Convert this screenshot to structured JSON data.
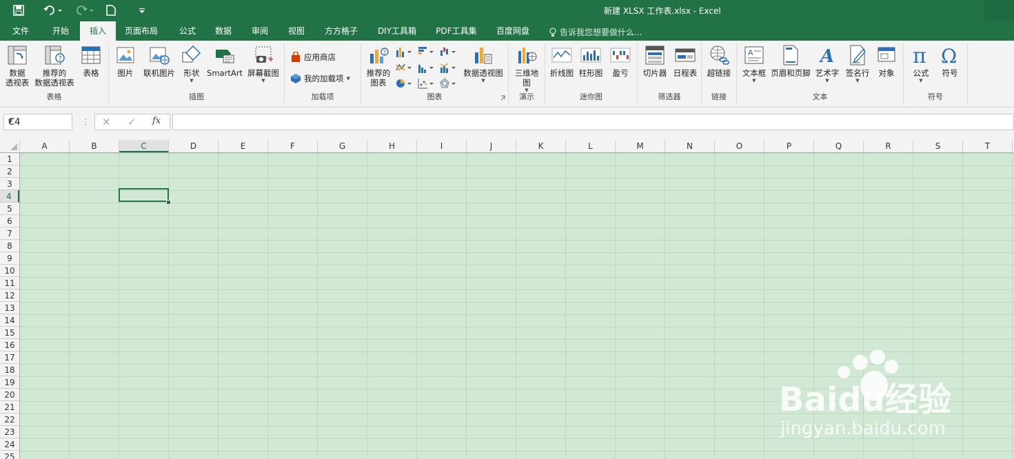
{
  "window": {
    "title": "新建 XLSX 工作表.xlsx - Excel"
  },
  "colors": {
    "brand": "#217346",
    "sheet_bg": "#d0e8d4",
    "gridline": "#bcd6c1"
  },
  "quick_access": {
    "icons": [
      "save-icon",
      "undo-icon",
      "redo-icon",
      "new-file-icon",
      "customize-icon"
    ]
  },
  "tabs": [
    "文件",
    "开始",
    "插入",
    "页面布局",
    "公式",
    "数据",
    "审阅",
    "视图",
    "方方格子",
    "DIY工具箱",
    "PDF工具集",
    "百度网盘"
  ],
  "active_tab": "插入",
  "tell_me": "告诉我您想要做什么...",
  "ribbon": {
    "tables": {
      "label": "表格",
      "pivot_line1": "数据",
      "pivot_line2": "透视表",
      "rec_line1": "推荐的",
      "rec_line2": "数据透视表",
      "table": "表格"
    },
    "illustrations": {
      "label": "插图",
      "picture": "图片",
      "online_picture": "联机图片",
      "shapes": "形状",
      "smartart": "SmartArt",
      "screenshot": "屏幕截图"
    },
    "addins": {
      "label": "加载项",
      "store": "应用商店",
      "my_addins": "我的加载项"
    },
    "charts": {
      "label": "图表",
      "rec_line1": "推荐的",
      "rec_line2": "图表",
      "pivot_chart": "数据透视图"
    },
    "tours": {
      "label": "演示",
      "line1": "三维地",
      "line2": "图"
    },
    "sparklines": {
      "label": "迷你图",
      "line": "折线图",
      "column": "柱形图",
      "winloss": "盈亏"
    },
    "filters": {
      "label": "筛选器",
      "slicer": "切片器",
      "timeline": "日程表"
    },
    "links": {
      "label": "链接",
      "hyperlink": "超链接"
    },
    "text": {
      "label": "文本",
      "textbox": "文本框",
      "header_footer": "页眉和页脚",
      "wordart": "艺术字",
      "signature": "签名行",
      "object": "对象"
    },
    "symbols": {
      "label": "符号",
      "equation": "公式",
      "symbol": "符号"
    }
  },
  "formula_bar": {
    "name_box": "C4",
    "formula": ""
  },
  "sheet": {
    "columns": [
      "A",
      "B",
      "C",
      "D",
      "E",
      "F",
      "G",
      "H",
      "I",
      "J",
      "K",
      "L",
      "M",
      "N",
      "O",
      "P",
      "Q",
      "R",
      "S",
      "T"
    ],
    "rows": [
      "1",
      "2",
      "3",
      "4",
      "5",
      "6",
      "7",
      "8",
      "9",
      "10",
      "11",
      "12",
      "13",
      "14",
      "15",
      "16",
      "17",
      "18",
      "19",
      "20",
      "21",
      "22",
      "23",
      "24",
      "25"
    ],
    "selected": "C4",
    "selected_col": "C",
    "selected_row": "4"
  },
  "watermark": {
    "brand": "Baidu经验",
    "url": "jingyan.baidu.com"
  }
}
